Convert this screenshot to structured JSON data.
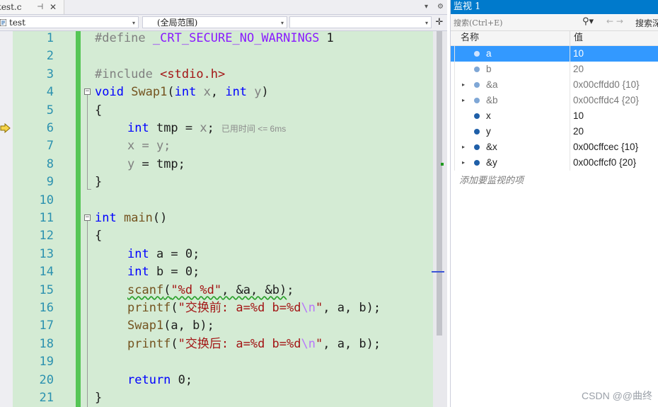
{
  "editor": {
    "tab": {
      "filename": "test.c",
      "pin_icon": "pin-icon",
      "close_icon": "close-icon"
    },
    "navbar": {
      "project": "test",
      "scope": "(全局范围)",
      "member": ""
    },
    "lines": [
      {
        "n": "1"
      },
      {
        "n": "2"
      },
      {
        "n": "3"
      },
      {
        "n": "4"
      },
      {
        "n": "5"
      },
      {
        "n": "6"
      },
      {
        "n": "7"
      },
      {
        "n": "8"
      },
      {
        "n": "9"
      },
      {
        "n": "10"
      },
      {
        "n": "11"
      },
      {
        "n": "12"
      },
      {
        "n": "13"
      },
      {
        "n": "14"
      },
      {
        "n": "15"
      },
      {
        "n": "16"
      },
      {
        "n": "17"
      },
      {
        "n": "18"
      },
      {
        "n": "19"
      },
      {
        "n": "20"
      },
      {
        "n": "21"
      }
    ],
    "code": {
      "define_kw": "#define",
      "define_name": "_CRT_SECURE_NO_WARNINGS",
      "define_val": " 1",
      "include_kw": "#include",
      "include_file": "<stdio.h>",
      "swap_kw": "void",
      "swap_name": "Swap1",
      "swap_params_open": "(",
      "int1": "int",
      "x_param": " x",
      "comma": ", ",
      "int2": "int",
      "y_param": " y",
      "close_paren": ")",
      "brace_open": "{",
      "brace_close": "}",
      "tmp_int": "int",
      "tmp_rest": " tmp = ",
      "tmp_x": "x",
      "semi": ";",
      "elapsed": "已用时间 <= 6ms",
      "line7": "x = y;",
      "line8_y": "y",
      "line8_rest": " = tmp;",
      "main_int": "int",
      "main_name": " main",
      "main_paren": "()",
      "a_int": "int",
      "a_rest": " a = 0;",
      "b_int": "int",
      "b_rest": " b = 0;",
      "scanf_fn": "scanf",
      "scanf_open": "(",
      "scanf_str": "\"%d %d\"",
      "scanf_rest": ", &a, &b)",
      "printf_fn": "printf",
      "printf1_str": "\"交换前: a=%d b=%d",
      "printf_esc": "\\n",
      "printf_q": "\"",
      "printf_args": ", a, b);",
      "swap_call_fn": "Swap1",
      "swap_call_args": "(a, b);",
      "printf2_str": "\"交换后: a=%d b=%d",
      "return_kw": "return",
      "return_rest": " 0;"
    }
  },
  "watch": {
    "title": "监视 1",
    "search_placeholder": "搜索(Ctrl+E)",
    "search_depth": "搜索深",
    "col_name": "名称",
    "col_value": "值",
    "rows": [
      {
        "expand": "",
        "name": "a",
        "value": "10"
      },
      {
        "expand": "",
        "name": "b",
        "value": "20"
      },
      {
        "expand": "▸",
        "name": "&a",
        "value": "0x00cffdd0 {10}"
      },
      {
        "expand": "▸",
        "name": "&b",
        "value": "0x00cffdc4 {20}"
      },
      {
        "expand": "",
        "name": "x",
        "value": "10"
      },
      {
        "expand": "",
        "name": "y",
        "value": "20"
      },
      {
        "expand": "▸",
        "name": "&x",
        "value": "0x00cffcec {10}"
      },
      {
        "expand": "▸",
        "name": "&y",
        "value": "0x00cffcf0 {20}"
      }
    ],
    "add_item": "添加要监视的项"
  },
  "watermark": "CSDN @@曲终",
  "colors": {
    "accent": "#007acc",
    "selection": "#3399ff",
    "changed_bar": "#55c655",
    "code_bg": "#d4ebd4"
  }
}
